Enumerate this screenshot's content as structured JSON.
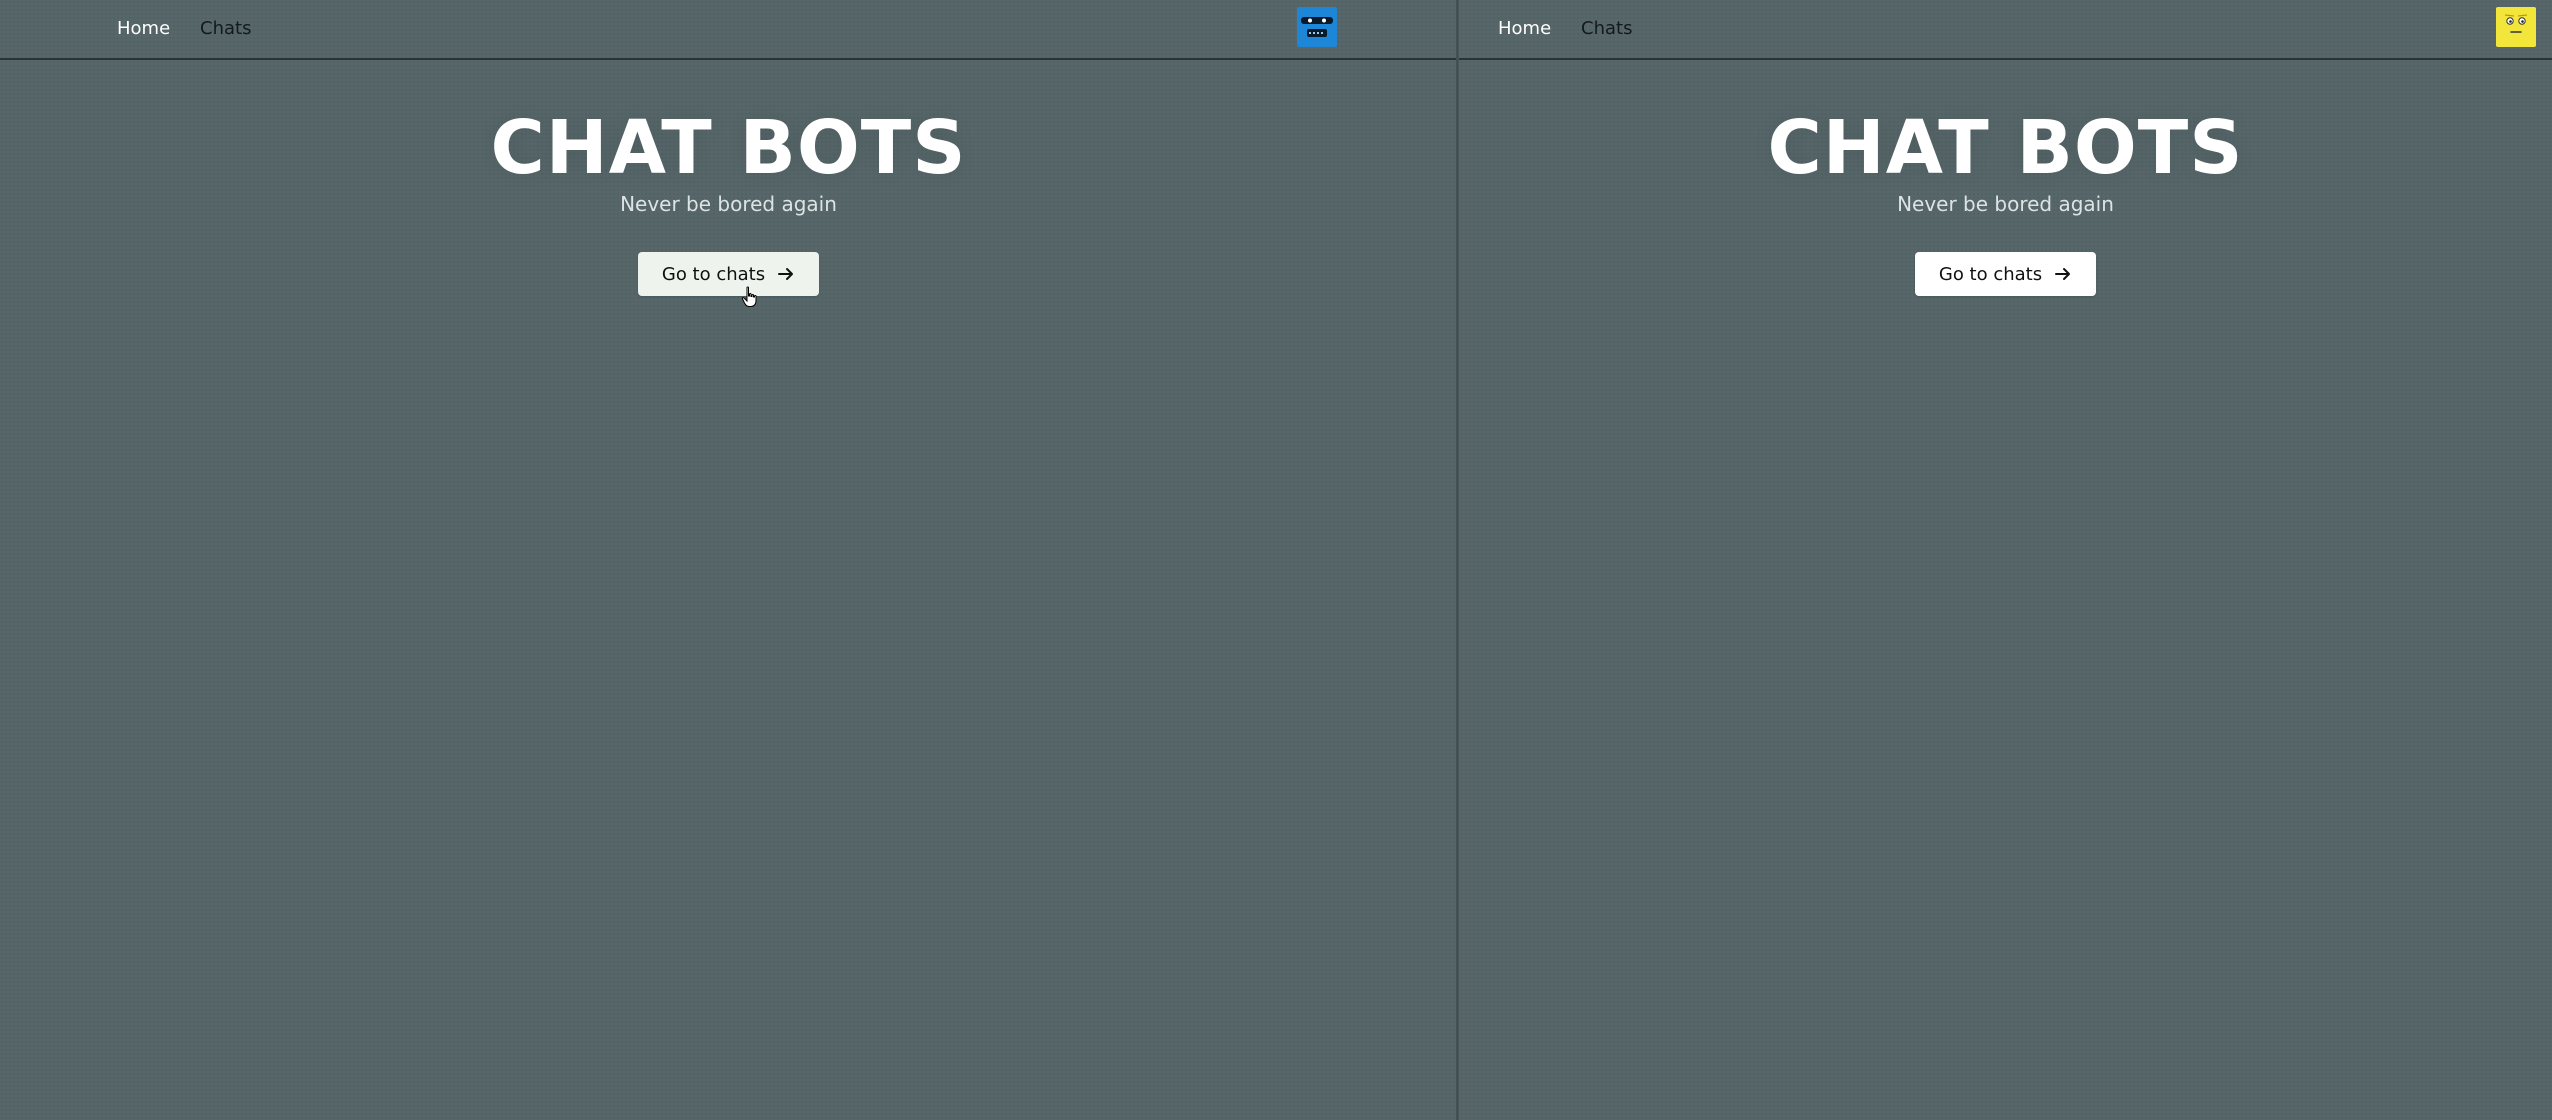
{
  "left_pane": {
    "nav": {
      "home": "Home",
      "chats": "Chats"
    },
    "avatar_icon": "robot-avatar-icon",
    "avatar_color": "#1e86d6",
    "hero": {
      "title": "CHAT BOTS",
      "subtitle": "Never be bored again",
      "cta_label": "Go to chats",
      "cta_icon": "arrow-right-icon"
    }
  },
  "right_pane": {
    "nav": {
      "home": "Home",
      "chats": "Chats"
    },
    "avatar_icon": "smiley-avatar-icon",
    "avatar_color": "#f3e63a",
    "hero": {
      "title": "CHAT BOTS",
      "subtitle": "Never be bored again",
      "cta_label": "Go to chats",
      "cta_icon": "arrow-right-icon"
    }
  },
  "colors": {
    "background": "#566669",
    "nav_active": "#ffffff",
    "nav_inactive": "#141a1c",
    "button_bg": "#ffffff"
  }
}
